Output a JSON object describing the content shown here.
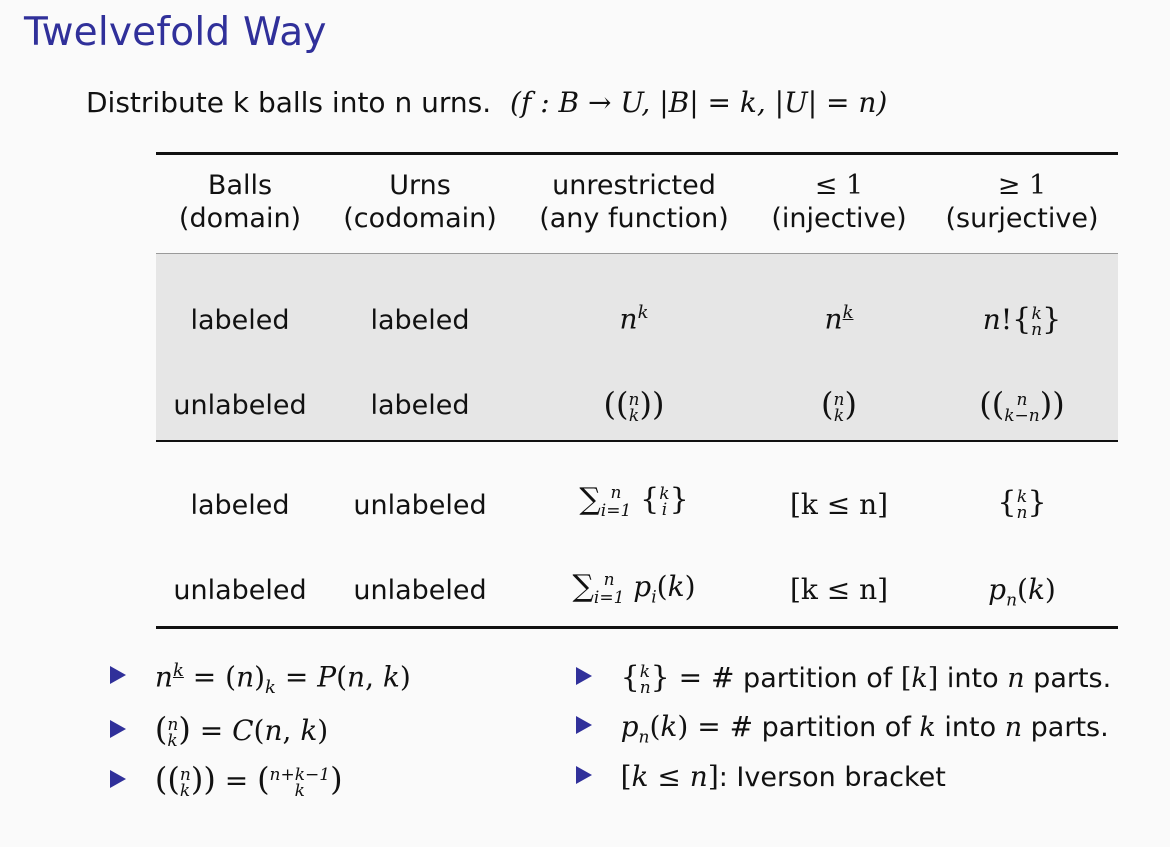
{
  "title": "Twelvefold Way",
  "intro": {
    "text": "Distribute k balls into n urns.",
    "formula": "(f : B → U, |B| = k, |U| = n)"
  },
  "table": {
    "headers": [
      {
        "line1": "Balls",
        "line2": "(domain)"
      },
      {
        "line1": "Urns",
        "line2": "(codomain)"
      },
      {
        "line1": "unrestricted",
        "line2": "(any function)"
      },
      {
        "line1": "≤ 1",
        "line2": "(injective)"
      },
      {
        "line1": "≥ 1",
        "line2": "(surjective)"
      }
    ],
    "rows": [
      [
        "labeled",
        "labeled",
        "nᵏ",
        "nᵏ (falling)",
        "n!{k n}"
      ],
      [
        "unlabeled",
        "labeled",
        "((n k))",
        "(n k)",
        "((n k−n))"
      ],
      [
        "labeled",
        "unlabeled",
        "∑ i=1..n {k i}",
        "[k ≤ n]",
        "{k n}"
      ],
      [
        "unlabeled",
        "unlabeled",
        "∑ i=1..n pᵢ(k)",
        "[k ≤ n]",
        "pₙ(k)"
      ]
    ]
  },
  "bullets_left": [
    "nᵏ = (n)ₖ = P(n, k)",
    "(n k) = C(n, k)",
    "((n k)) = (n+k−1 k)"
  ],
  "bullets_right": [
    "{k n} = # partition of [k] into n parts.",
    "pₙ(k) = # partition of k into n parts.",
    "[k ≤ n]: Iverson bracket"
  ],
  "colors": {
    "title": "#30309a",
    "bullet": "#30309a",
    "shade": "#e6e6e6"
  }
}
